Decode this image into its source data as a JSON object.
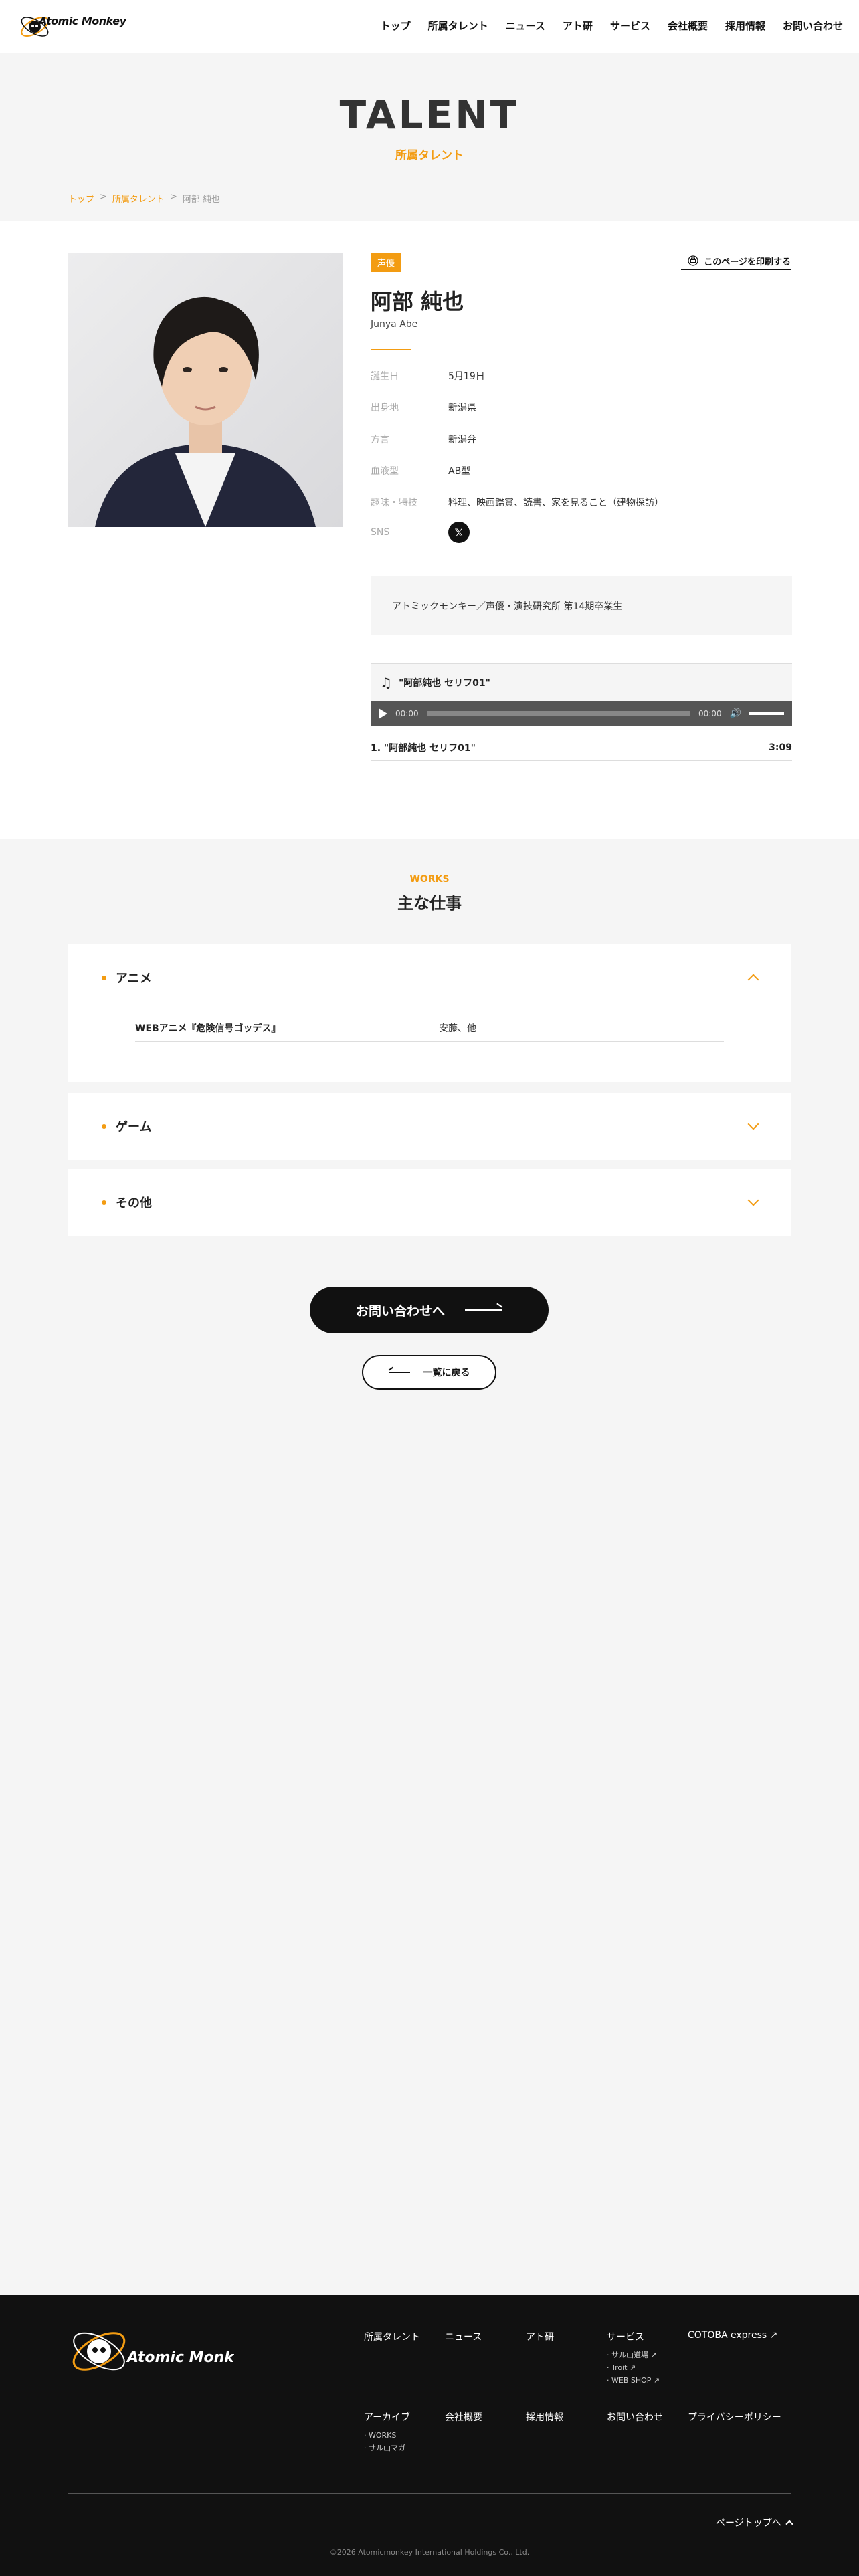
{
  "header": {
    "logo_text": "Atomic Monkey",
    "nav": [
      "トップ",
      "所属タレント",
      "ニュース",
      "アト研",
      "サービス",
      "会社概要",
      "採用情報",
      "お問い合わせ"
    ]
  },
  "hero": {
    "title": "TALENT",
    "subtitle": "所属タレント"
  },
  "breadcrumb": [
    "トップ",
    ">",
    "所属タレント",
    ">",
    "阿部 純也"
  ],
  "profile": {
    "tag": "声優",
    "print_label": "このページを印刷する",
    "name": "阿部 純也",
    "name_en": "Junya Abe",
    "info": [
      {
        "k": "誕生日",
        "v": "5月19日"
      },
      {
        "k": "出身地",
        "v": "新潟県"
      },
      {
        "k": "方言",
        "v": "新潟弁"
      },
      {
        "k": "血液型",
        "v": "AB型"
      },
      {
        "k": "趣味・特技",
        "v": "料理、映画鑑賞、読書、家を見ること（建物探訪）"
      },
      {
        "k": "SNS",
        "v": ""
      }
    ],
    "sns_icon": "x-icon",
    "bio": "アトミックモンキー／声優・演技研究所 第14期卒業生"
  },
  "audio": {
    "title": "\"阿部純也 セリフ01\"",
    "time_current": "00:00",
    "time_total": "00:00",
    "track_label": "1. \"阿部純也 セリフ01\"",
    "track_duration": "3:09",
    "progress": 0
  },
  "works": {
    "label": "WORKS",
    "title": "主な仕事",
    "categories": [
      {
        "name": "アニメ",
        "expanded": true,
        "rows": [
          {
            "title": "WEBアニメ『危険信号ゴッデス』",
            "role": "安藤、他"
          }
        ]
      },
      {
        "name": "ゲーム",
        "expanded": false
      },
      {
        "name": "その他",
        "expanded": false
      }
    ]
  },
  "buttons": {
    "contact": "お問い合わせへ",
    "back": "一覧に戻る"
  },
  "footer": {
    "row1": [
      "所属タレント",
      "ニュース",
      "アト研",
      "サービス",
      "COTOBA express"
    ],
    "service_sub": [
      "サル山道場",
      "Troit",
      "WEB SHOP"
    ],
    "row2": [
      "アーカイブ",
      "会社概要",
      "採用情報",
      "お問い合わせ",
      "プライバシーポリシー"
    ],
    "archive_sub": [
      "WORKS",
      "サル山マガ"
    ],
    "pagetop": "ページトップへ",
    "copyright": "©2026 Atomicmonkey International Holdings Co., Ltd."
  },
  "colors": {
    "accent": "#f39c12",
    "dark": "#111111",
    "bg": "#f5f5f5"
  }
}
